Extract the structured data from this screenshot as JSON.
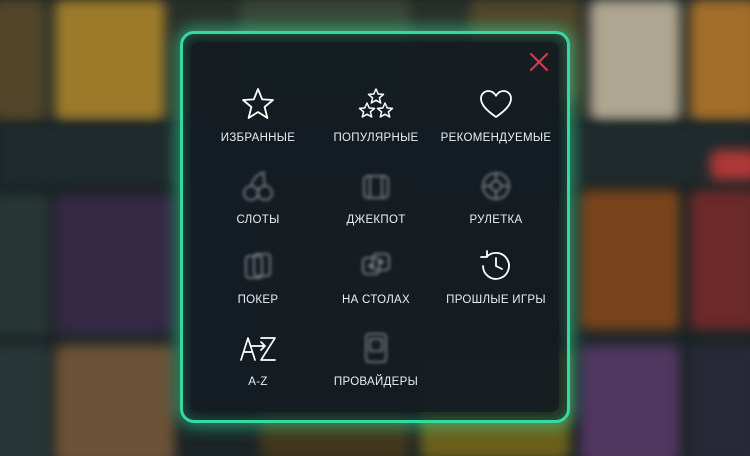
{
  "menu": {
    "items": [
      {
        "label": "ИЗБРАННЫЕ",
        "icon": "star-icon"
      },
      {
        "label": "ПОПУЛЯРНЫЕ",
        "icon": "stars-icon"
      },
      {
        "label": "РЕКОМЕНДУЕМЫЕ",
        "icon": "heart-icon"
      },
      {
        "label": "СЛОТЫ",
        "icon": "cherry-icon"
      },
      {
        "label": "ДЖЕКПОТ",
        "icon": "jackpot-icon"
      },
      {
        "label": "РУЛЕТКА",
        "icon": "roulette-icon"
      },
      {
        "label": "ПОКЕР",
        "icon": "poker-cards-icon"
      },
      {
        "label": "НА СТОЛАХ",
        "icon": "dice-icon"
      },
      {
        "label": "ПРОШЛЫЕ ИГРЫ",
        "icon": "history-icon"
      },
      {
        "label": "A-Z",
        "icon": "a-z-icon"
      },
      {
        "label": "ПРОВАЙДЕРЫ",
        "icon": "providers-icon"
      }
    ],
    "close_icon": "close-icon"
  },
  "colors": {
    "accent_glow": "#38d9a0",
    "close": "#d23a4a",
    "text": "#e9eef2"
  }
}
